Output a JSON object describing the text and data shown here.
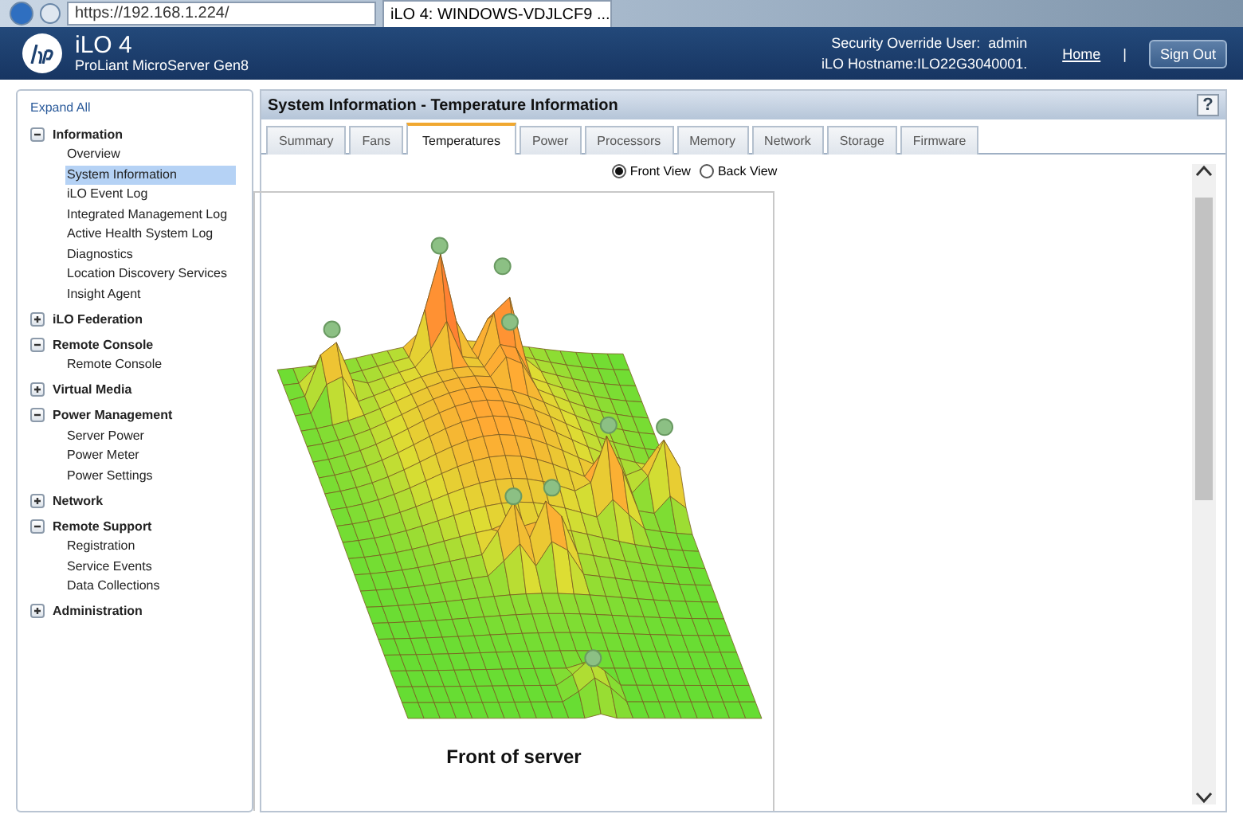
{
  "browser": {
    "address": "https://192.168.1.224/",
    "tab_title": "iLO 4: WINDOWS-VDJLCF9 ..."
  },
  "header": {
    "product": "iLO 4",
    "model": "ProLiant MicroServer Gen8",
    "user_line": "Security Override User:  admin",
    "hostname_line": "iLO Hostname:ILO22G3040001.",
    "home_link": "Home",
    "separator": "|",
    "sign_out": "Sign Out"
  },
  "sidebar": {
    "expand_all": "Expand All",
    "items": [
      {
        "label": "Information",
        "expanded": true,
        "children": [
          {
            "label": "Overview",
            "selected": false
          },
          {
            "label": "System Information",
            "selected": true
          },
          {
            "label": "iLO Event Log",
            "selected": false
          },
          {
            "label": "Integrated Management Log",
            "selected": false
          },
          {
            "label": "Active Health System Log",
            "selected": false
          },
          {
            "label": "Diagnostics",
            "selected": false
          },
          {
            "label": "Location Discovery Services",
            "selected": false
          },
          {
            "label": "Insight Agent",
            "selected": false
          }
        ]
      },
      {
        "label": "iLO Federation",
        "expanded": false
      },
      {
        "label": "Remote Console",
        "expanded": true,
        "children": [
          {
            "label": "Remote Console",
            "selected": false
          }
        ]
      },
      {
        "label": "Virtual Media",
        "expanded": false
      },
      {
        "label": "Power Management",
        "expanded": true,
        "children": [
          {
            "label": "Server Power",
            "selected": false
          },
          {
            "label": "Power Meter",
            "selected": false
          },
          {
            "label": "Power Settings",
            "selected": false
          }
        ]
      },
      {
        "label": "Network",
        "expanded": false
      },
      {
        "label": "Remote Support",
        "expanded": true,
        "children": [
          {
            "label": "Registration",
            "selected": false
          },
          {
            "label": "Service Events",
            "selected": false
          },
          {
            "label": "Data Collections",
            "selected": false
          }
        ]
      },
      {
        "label": "Administration",
        "expanded": false
      }
    ]
  },
  "panel": {
    "title": "System Information - Temperature Information",
    "help": "?",
    "tabs": [
      {
        "label": "Summary",
        "selected": false
      },
      {
        "label": "Fans",
        "selected": false
      },
      {
        "label": "Temperatures",
        "selected": true
      },
      {
        "label": "Power",
        "selected": false
      },
      {
        "label": "Processors",
        "selected": false
      },
      {
        "label": "Memory",
        "selected": false
      },
      {
        "label": "Network",
        "selected": false
      },
      {
        "label": "Storage",
        "selected": false
      },
      {
        "label": "Firmware",
        "selected": false
      }
    ],
    "views": [
      {
        "label": "Front View",
        "selected": true
      },
      {
        "label": "Back View",
        "selected": false
      }
    ],
    "caption": "Front of server"
  }
}
